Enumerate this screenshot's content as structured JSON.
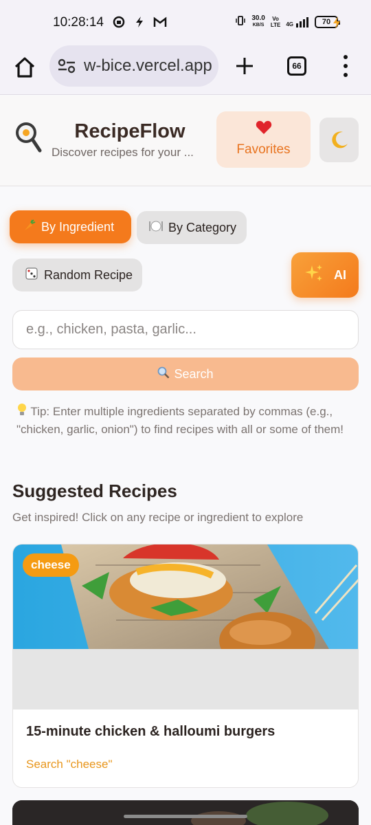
{
  "status_bar": {
    "time": "10:28:14",
    "network_speed_value": "30.0",
    "network_speed_unit": "KB/S",
    "battery": "70",
    "network_type": "4G"
  },
  "browser": {
    "url": "w-bice.vercel.app",
    "tab_count": "66"
  },
  "header": {
    "title": "RecipeFlow",
    "subtitle": "Discover recipes for your ...",
    "favorites_label": "Favorites"
  },
  "modes": {
    "by_ingredient": "By Ingredient",
    "by_category": "By Category",
    "random": "Random Recipe",
    "ai": "AI"
  },
  "search": {
    "placeholder": "e.g., chicken, pasta, garlic...",
    "value": "",
    "button_label": "Search",
    "tip": "Tip: Enter multiple ingredients separated by commas (e.g., \"chicken, garlic, onion\") to find recipes with all or some of them!"
  },
  "suggested": {
    "title": "Suggested Recipes",
    "subtitle": "Get inspired! Click on any recipe or ingredient to explore",
    "cards": [
      {
        "badge": "cheese",
        "title": "15-minute chicken & halloumi burgers",
        "link": "Search \"cheese\""
      }
    ]
  },
  "colors": {
    "accent": "#f47a1c",
    "badge": "#f59b12",
    "link": "#e8961c"
  }
}
